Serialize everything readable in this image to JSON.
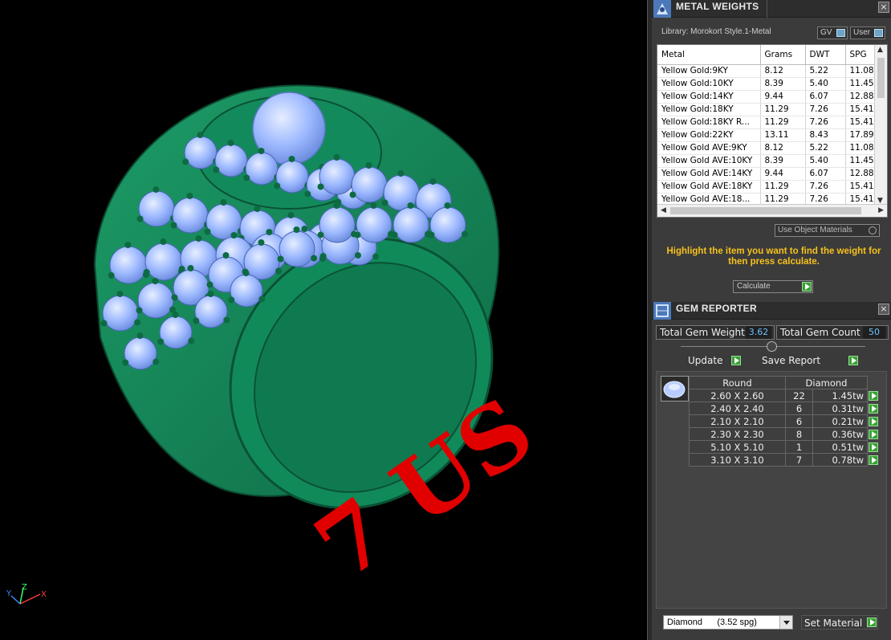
{
  "viewport": {
    "size_label": "7 US",
    "axis": {
      "z": "Z",
      "y": "Y",
      "x": "X"
    }
  },
  "metal_weights": {
    "title": "METAL WEIGHTS",
    "library_label": "Library: Morokort Style.1-Metal",
    "toggle_gv": "GV",
    "toggle_user": "User",
    "columns": [
      "Metal",
      "Grams",
      "DWT",
      "SPG"
    ],
    "rows": [
      [
        "Yellow Gold:9KY",
        "8.12",
        "5.22",
        "11.08"
      ],
      [
        "Yellow Gold:10KY",
        "8.39",
        "5.40",
        "11.45"
      ],
      [
        "Yellow Gold:14KY",
        "9.44",
        "6.07",
        "12.88"
      ],
      [
        "Yellow Gold:18KY",
        "11.29",
        "7.26",
        "15.41"
      ],
      [
        "Yellow Gold:18KY R...",
        "11.29",
        "7.26",
        "15.41"
      ],
      [
        "Yellow Gold:22KY",
        "13.11",
        "8.43",
        "17.89"
      ],
      [
        "Yellow Gold AVE:9KY",
        "8.12",
        "5.22",
        "11.08"
      ],
      [
        "Yellow Gold AVE:10KY",
        "8.39",
        "5.40",
        "11.45"
      ],
      [
        "Yellow Gold AVE:14KY",
        "9.44",
        "6.07",
        "12.88"
      ],
      [
        "Yellow Gold AVE:18KY",
        "11.29",
        "7.26",
        "15.41"
      ],
      [
        "Yellow Gold AVE:18...",
        "11.29",
        "7.26",
        "15.41"
      ]
    ],
    "use_object_materials": "Use Object Materials",
    "message": "Highlight the item you want to find the weight for then press calculate.",
    "calculate_label": "Calculate"
  },
  "gem_reporter": {
    "title": "GEM REPORTER",
    "total_weight_label": "Total Gem Weight",
    "total_weight_value": "3.62",
    "total_count_label": "Total Gem Count",
    "total_count_value": "50",
    "update_label": "Update",
    "save_report_label": "Save Report",
    "table_headers": [
      "Round",
      "Diamond"
    ],
    "rows": [
      {
        "size": "2.60 X 2.60",
        "count": "22",
        "tw": "1.45tw"
      },
      {
        "size": "2.40 X 2.40",
        "count": "6",
        "tw": "0.31tw"
      },
      {
        "size": "2.10 X 2.10",
        "count": "6",
        "tw": "0.21tw"
      },
      {
        "size": "2.30 X 2.30",
        "count": "8",
        "tw": "0.36tw"
      },
      {
        "size": "5.10 X 5.10",
        "count": "1",
        "tw": "0.51tw"
      },
      {
        "size": "3.10 X 3.10",
        "count": "7",
        "tw": "0.78tw"
      }
    ],
    "material_select": "Diamond      (3.52 spg)",
    "set_material_label": "Set Material"
  },
  "colors": {
    "metal": "#16875a",
    "gem": "#9cb8ff",
    "label_red": "#e10000",
    "message_yellow": "#f7c21c",
    "go_green": "#3aa135"
  }
}
